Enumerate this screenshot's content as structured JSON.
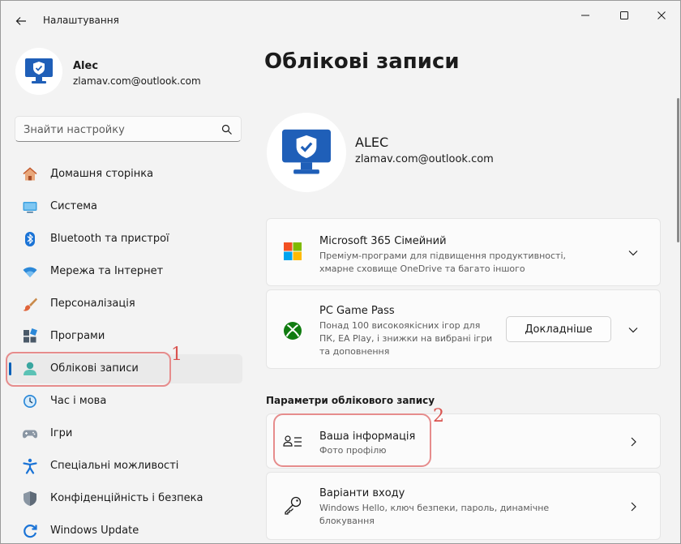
{
  "window": {
    "title": "Налаштування",
    "controls": {
      "minimize": "minimize",
      "maximize": "maximize",
      "close": "close"
    }
  },
  "sidebar": {
    "profile": {
      "name": "Alec",
      "email": "zlamav.com@outlook.com"
    },
    "search": {
      "placeholder": "Знайти настройку"
    },
    "items": [
      {
        "label": "Домашня сторінка",
        "icon": "home-icon"
      },
      {
        "label": "Система",
        "icon": "system-icon"
      },
      {
        "label": "Bluetooth та пристрої",
        "icon": "bluetooth-icon"
      },
      {
        "label": "Мережа та Інтернет",
        "icon": "wifi-icon"
      },
      {
        "label": "Персоналізація",
        "icon": "brush-icon"
      },
      {
        "label": "Програми",
        "icon": "apps-icon"
      },
      {
        "label": "Облікові записи",
        "icon": "accounts-icon",
        "active": true
      },
      {
        "label": "Час і мова",
        "icon": "clock-icon"
      },
      {
        "label": "Ігри",
        "icon": "gamepad-icon"
      },
      {
        "label": "Спеціальні можливості",
        "icon": "accessibility-icon"
      },
      {
        "label": "Конфіденційність і безпека",
        "icon": "shield-icon"
      },
      {
        "label": "Windows Update",
        "icon": "update-icon"
      }
    ]
  },
  "annotations": {
    "one": "1",
    "two": "2"
  },
  "main": {
    "title": "Облікові записи",
    "account": {
      "name": "ALEC",
      "email": "zlamav.com@outlook.com"
    },
    "cards": {
      "ms365": {
        "title": "Microsoft 365 Сімейний",
        "desc1": "Преміум-програми для підвищення продуктивності,",
        "desc2": "хмарне сховище OneDrive та багато іншого"
      },
      "gamepass": {
        "title": "PC Game Pass",
        "desc1": "Понад 100 високоякісних ігор для",
        "desc2": "ПК, EA Play, і знижки на вибрані ігри",
        "desc3": "та доповнення",
        "button": "Докладніше"
      }
    },
    "section_label": "Параметри облікового запису",
    "settings": {
      "info": {
        "title": "Ваша інформація",
        "desc": "Фото профілю"
      },
      "signin": {
        "title": "Варіанти входу",
        "desc1": "Windows Hello, ключ безпеки, пароль, динамічне",
        "desc2": "блокування"
      }
    }
  },
  "colors": {
    "accent": "#005fb8",
    "annotation": "#d9534f",
    "background": "#f3f3f3"
  }
}
